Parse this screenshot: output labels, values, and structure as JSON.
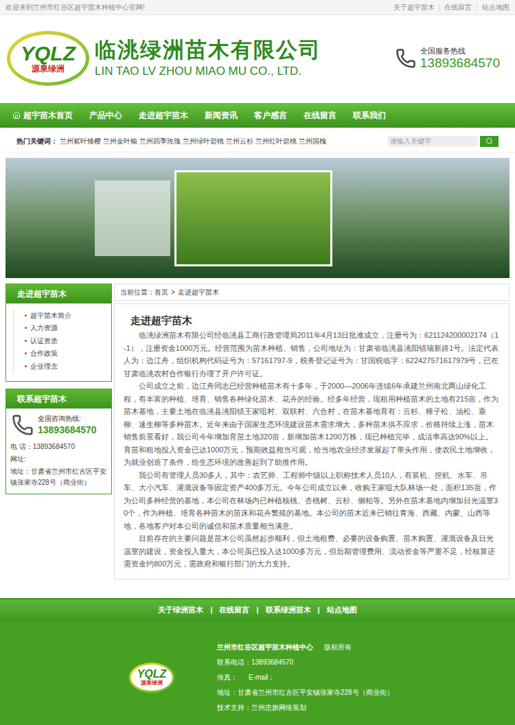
{
  "topbar": {
    "welcome": "欢迎来到兰州市红谷区超宇苗木种植中心官网!",
    "links": [
      "关于超宇苗木",
      "在线留言",
      "站点地图"
    ],
    "separator": "|"
  },
  "header": {
    "logo": {
      "letters": "YQLZ",
      "name": "源泉绿洲"
    },
    "company": "临洮绿洲苗木有限公司",
    "company_en": "LIN TAO LV ZHOU MIAO MU CO., LTD.",
    "hotline_label": "全国服务热线",
    "hotline": "13893684570"
  },
  "nav": [
    {
      "label": "超宇苗木首页",
      "selected": false
    },
    {
      "label": "产品中心",
      "selected": false
    },
    {
      "label": "走进超宇苗木",
      "selected": false
    },
    {
      "label": "新闻资讯",
      "selected": false
    },
    {
      "label": "客户感言",
      "selected": false
    },
    {
      "label": "在线留言",
      "selected": false
    },
    {
      "label": "联系我们",
      "selected": false
    }
  ],
  "hot_keywords": {
    "label": "热门关键词：",
    "items": [
      "兰州紫叶矮樱",
      "兰州金叶榆",
      "兰州四季玫瑰",
      "兰州绿叶碧桃",
      "兰州云杉",
      "兰州红叶碧桃",
      "兰州国槐"
    ]
  },
  "search": {
    "placeholder": "请输入关键字"
  },
  "sidebar": {
    "about": {
      "title": "走进超宇苗木",
      "items": [
        "超宇苗木简介",
        "人力资源",
        "认证资质",
        "合作政策",
        "企业理念"
      ]
    },
    "contact": {
      "title": "联系超宇苗木",
      "hotline_label": "全国咨询热线:",
      "hotline": "13893684570",
      "lines": [
        "电 话：13893684570",
        "网址:",
        "地址：甘肃省兰州市红古区平安镇张家寺228号（商业街）"
      ]
    }
  },
  "breadcrumb": {
    "prefix": "当前位置：",
    "items": [
      "首页",
      "走进超宇苗木"
    ],
    "separator": ">"
  },
  "article": {
    "title": "走进超宇苗木",
    "paragraphs": [
      "临洮绿洲苗木有限公司经临洮县工商行政管理局2011年4月13日批准成立，注册号为：621124200002174（1-1），注册资金1000万元。经营范围为苗木种植、销售，公司地址为：甘肃省临洮县洮阳镇瑞新路1号。法定代表人为：边江舟，组织机构代码证号为：57161797-9，税务登记证号为：甘国税临字：622427571617979号，已在甘肃临洮农村合作银行办理了开户许可证。",
      "公司成立之前，边江舟同志已经营种植苗木有十多年，于2000—2006年连续6年承建兰州南北两山绿化工程，有丰富的种植、培育、销售各种绿化苗木、花卉的经验。经多年经营，现租用种植苗木的土地有215亩，作为苗木基地，主要土地在临洮县洮阳镇王家咀村、双联村、六合村，在苗木基地育有：云杉、樟子松、油松、垂柳、速生柳等多种苗木。近年来由于国家生态环境建设苗木需求增大，多种苗木供不应求，价格持续上涨，苗木销售前景看好，我公司今年增加育苗土地320亩，新增加苗木1200万株，现已种植完毕，成活率高达90%以上。育苗和租地投入资金已达1000万元，预期效益相当可观，给当地农业经济发展起了带头作用，使农民土地增收，为就业创造了条件，给生态环境的改善起到了助推作用。",
      "我公司有管理人员30多人，其中：农艺师、工程师中级以上职称技术人员10人，有装机、挖机、水车、吊车、大小汽车、灌溉设备等固定资产400多万元。今年公司成立以来，收购王家咀大队林场一处，面积135亩，作为公司多种经营的基地，本公司在林场内已种植核桃、杏桃树、云杉、侧柏等。另外在苗木基地内增加日光温室30个，作为种植、培育各种苗木的苗床和花卉繁殖的基地。本公司的苗木近来已销往青海、西藏、内蒙、山西等地，各地客户对本公司的诚信和苗木质量相当满意。",
      "目前存在的主要问题是苗木公司虽然起步顺利，但土地租费、必要的设备购置、苗木购置、灌溉设备及日光温室的建设，资金投入量大，本公司虽已投入达1000多万元，但后期管理费用、流动资金等严重不足，经核算还需资金约800万元，需政府和银行部门的大力支持。"
    ]
  },
  "footer": {
    "links": [
      "关于绿洲苗木",
      "在线留言",
      "联系绿洲苗木",
      "站点地图"
    ],
    "separator": "|",
    "company": "兰州市红谷区超宇苗木种植中心",
    "copyright": "版权所有",
    "phone": "联系电话：13893684570",
    "fax": "传真：",
    "email": "E-mail：",
    "address": "地址：甘肃省兰州市红古区平安镇张家寺228号（商业街）",
    "support": "技术支持：兰州忠旗网络策划"
  }
}
